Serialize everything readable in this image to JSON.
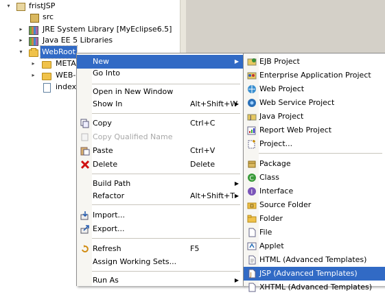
{
  "tree": {
    "items": [
      {
        "label": "fristJSP",
        "twisty": "▾"
      },
      {
        "label": "src",
        "twisty": ""
      },
      {
        "label": "JRE System Library [MyEclipse6.5]",
        "twisty": "▸"
      },
      {
        "label": "Java EE 5 Libraries",
        "twisty": "▸"
      },
      {
        "label": "WebRoot",
        "twisty": "▾"
      },
      {
        "label": "META-",
        "twisty": "▸"
      },
      {
        "label": "WEB-I",
        "twisty": "▸"
      },
      {
        "label": "index.",
        "twisty": ""
      }
    ]
  },
  "context_menu": {
    "items": [
      {
        "label": "New",
        "accel": "",
        "submenu": true
      },
      {
        "label": "Go Into",
        "accel": ""
      },
      {
        "label": "Open in New Window",
        "accel": ""
      },
      {
        "label": "Show In",
        "accel": "Alt+Shift+W",
        "submenu": true
      },
      {
        "label": "Copy",
        "accel": "Ctrl+C"
      },
      {
        "label": "Copy Qualified Name",
        "accel": "",
        "disabled": true
      },
      {
        "label": "Paste",
        "accel": "Ctrl+V"
      },
      {
        "label": "Delete",
        "accel": "Delete"
      },
      {
        "label": "Build Path",
        "accel": "",
        "submenu": true
      },
      {
        "label": "Refactor",
        "accel": "Alt+Shift+T",
        "submenu": true
      },
      {
        "label": "Import...",
        "accel": ""
      },
      {
        "label": "Export...",
        "accel": ""
      },
      {
        "label": "Refresh",
        "accel": "F5"
      },
      {
        "label": "Assign Working Sets...",
        "accel": ""
      },
      {
        "label": "Run As",
        "accel": "",
        "submenu": true
      }
    ]
  },
  "new_submenu": {
    "items": [
      {
        "label": "EJB Project"
      },
      {
        "label": "Enterprise Application Project"
      },
      {
        "label": "Web Project"
      },
      {
        "label": "Web Service Project"
      },
      {
        "label": "Java Project"
      },
      {
        "label": "Report Web Project"
      },
      {
        "label": "Project..."
      },
      {
        "label": "Package"
      },
      {
        "label": "Class"
      },
      {
        "label": "Interface"
      },
      {
        "label": "Source Folder"
      },
      {
        "label": "Folder"
      },
      {
        "label": "File"
      },
      {
        "label": "Applet"
      },
      {
        "label": "HTML (Advanced Templates)"
      },
      {
        "label": "JSP (Advanced Templates)"
      },
      {
        "label": "XHTML (Advanced Templates)"
      }
    ]
  },
  "colors": {
    "selection": "#316ac5",
    "panel": "#d4d0c8",
    "disabled": "#a8a8a8"
  }
}
